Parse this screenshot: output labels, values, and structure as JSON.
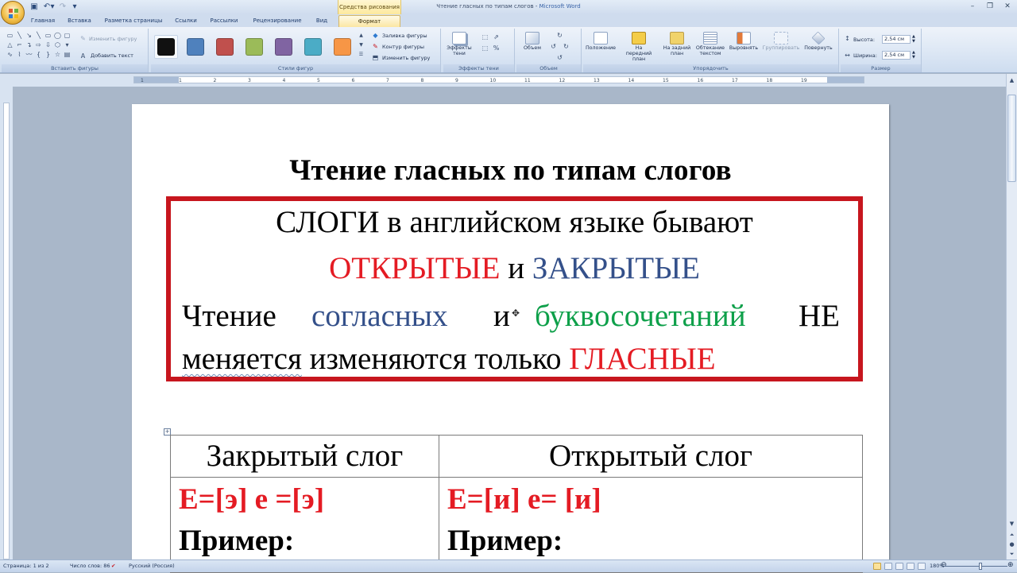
{
  "app": {
    "window_title_doc": "Чтение гласных по типам слогов",
    "window_title_sep": " - ",
    "window_title_app": "Microsoft Word",
    "contextual_label": "Средства рисования"
  },
  "tabs": [
    "Главная",
    "Вставка",
    "Разметка страницы",
    "Ссылки",
    "Рассылки",
    "Рецензирование",
    "Вид",
    "Формат"
  ],
  "ribbon": {
    "insert_shapes": {
      "label": "Вставить фигуры",
      "edit_shape": "Изменить фигуру",
      "add_text": "Добавить текст"
    },
    "shape_styles": {
      "label": "Стили фигур",
      "swatches": [
        "#111111",
        "#4f81bd",
        "#c0504d",
        "#9bbb59",
        "#8064a2",
        "#4bacc6",
        "#f79646"
      ],
      "fill": "Заливка фигуры",
      "outline": "Контур фигуры",
      "change": "Изменить фигуру"
    },
    "shadow_effects": {
      "label": "Эффекты тени",
      "button": "Эффекты тени"
    },
    "volume": {
      "label": "Объем",
      "button": "Объем"
    },
    "arrange": {
      "label": "Упорядочить",
      "position": "Положение",
      "bring_front": "На передний план",
      "send_back": "На задний план",
      "text_wrap": "Обтекание текстом",
      "align": "Выровнять",
      "group": "Группировать",
      "rotate": "Повернуть"
    },
    "size": {
      "label": "Размер",
      "height_label": "Высота:",
      "height_value": "2,54 см",
      "width_label": "Ширина:",
      "width_value": "2,54 см"
    }
  },
  "ruler_numbers": [
    "1",
    "1",
    "2",
    "3",
    "4",
    "5",
    "6",
    "7",
    "8",
    "9",
    "10",
    "11",
    "12",
    "13",
    "14",
    "15",
    "16",
    "17",
    "18",
    "19"
  ],
  "document": {
    "title": "Чтение гласных по типам слогов",
    "frame": {
      "line1": "СЛОГИ в английском языке бывают",
      "open_word": "ОТКРЫТЫЕ",
      "and": "и",
      "closed_word": "ЗАКРЫТЫЕ",
      "line3_reading": "Чтение",
      "line3_consonants": "согласных",
      "line3_and": "и",
      "line3_combos": "буквосочетаний",
      "line3_not": "НЕ",
      "line4_changes": "меняется",
      "line4_middle": " изменяются только ",
      "line4_vowels": "ГЛАСНЫЕ"
    },
    "table": {
      "headers": [
        "Закрытый слог",
        "Открытый слог"
      ],
      "rules": [
        "Е=[э] е =[э]",
        "Е=[и] е= [и]"
      ],
      "example_label": "Пример:"
    }
  },
  "status": {
    "page": "Страница: 1 из 2",
    "words": "Число слов: 86",
    "language": "Русский (Россия)",
    "zoom": "180%"
  },
  "colors": {
    "frame_border": "#c7161e",
    "red_text": "#e41b23",
    "blue_text": "#34508a",
    "green_text": "#0ea04a"
  }
}
